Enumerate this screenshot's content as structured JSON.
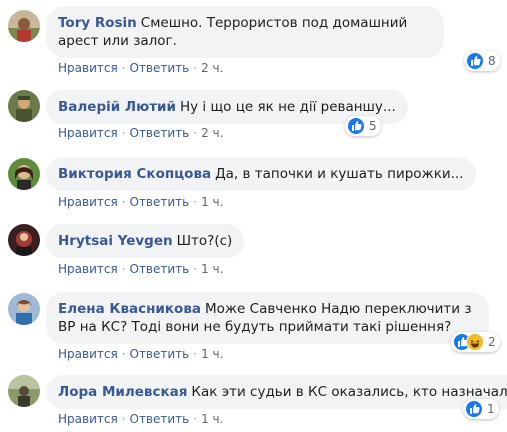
{
  "actions": {
    "like": "Нравится",
    "reply": "Ответить",
    "separator": "·"
  },
  "colors": {
    "link": "#385898",
    "bubble": "#f2f3f5",
    "like_blue": "#1877f2",
    "haha_yellow": "#f7b928"
  },
  "comments": [
    {
      "author": "Tory Rosin",
      "text": "Смешно. Террористов под домашний арест или залог.",
      "time": "2 ч.",
      "reactions": [
        "like-icon"
      ],
      "reaction_count": "8"
    },
    {
      "author": "Валерій Лютий",
      "text": "Ну і що це як не дії реваншу...",
      "time": "2 ч.",
      "reactions": [
        "like-icon"
      ],
      "reaction_count": "5"
    },
    {
      "author": "Виктория Скопцова",
      "text": "Да, в тапочки и кушать пирожки...",
      "time": "1 ч."
    },
    {
      "author": "Hrytsai Yevgen",
      "text": "Што?(с)",
      "time": "1 ч."
    },
    {
      "author": "Елена Квасникова",
      "text": "Може Савченко Надю переключити з ВР на КС? Тоді вони не будуть приймати такі рішення?",
      "time": "1 ч.",
      "reactions": [
        "like-icon",
        "haha-icon"
      ],
      "reaction_count": "2"
    },
    {
      "author": "Лора Милевская",
      "text": "Как эти судьи в КС оказались, кто назначал?",
      "time": "1 ч.",
      "reactions": [
        "like-icon"
      ],
      "reaction_count": "1"
    }
  ]
}
